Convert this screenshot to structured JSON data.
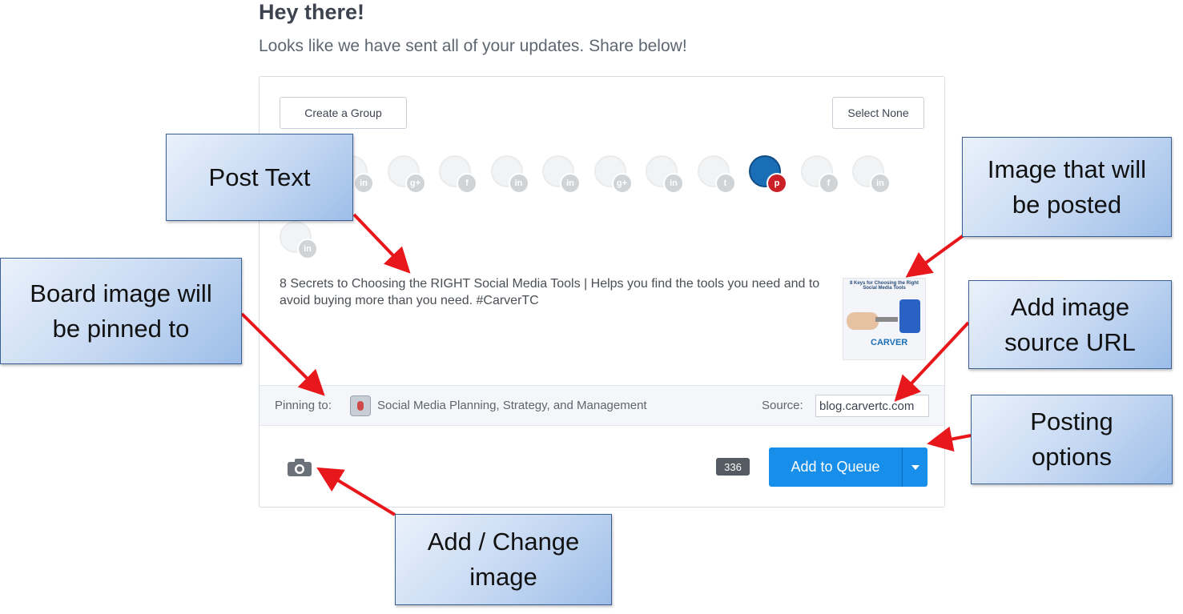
{
  "greeting": {
    "title": "Hey there!",
    "subtitle": "Looks like we have sent all of your updates. Share below!"
  },
  "composer": {
    "create_group_label": "Create a Group",
    "select_none_label": "Select None",
    "profiles": [
      {
        "network": "linkedin",
        "badge": "in",
        "active": false
      },
      {
        "network": "google-plus",
        "badge": "g+",
        "active": false
      },
      {
        "network": "facebook",
        "badge": "f",
        "active": false
      },
      {
        "network": "linkedin",
        "badge": "in",
        "active": false
      },
      {
        "network": "linkedin",
        "badge": "in",
        "active": false
      },
      {
        "network": "google-plus",
        "badge": "g+",
        "active": false
      },
      {
        "network": "linkedin",
        "badge": "in",
        "active": false
      },
      {
        "network": "twitter",
        "badge": "t",
        "active": false
      },
      {
        "network": "pinterest",
        "badge": "p",
        "active": true
      },
      {
        "network": "facebook",
        "badge": "f",
        "active": false
      },
      {
        "network": "linkedin",
        "badge": "in",
        "active": false
      },
      {
        "network": "linkedin",
        "badge": "in",
        "active": false
      }
    ],
    "post_text": "8 Secrets to Choosing the RIGHT Social Media Tools | Helps you find the tools you need and to avoid buying more than you need. #CarverTC",
    "thumbnail": {
      "title": "8 Keys for Choosing the Right Social Media Tools",
      "logo": "CARVER"
    },
    "pin_bar": {
      "pinning_label": "Pinning to:",
      "board_name": "Social Media Planning, Strategy, and Management",
      "source_label": "Source:",
      "source_value": "blog.carvertc.com"
    },
    "char_count": "336",
    "add_to_queue_label": "Add to Queue"
  },
  "callouts": {
    "post_text": [
      "Post Text"
    ],
    "image": [
      "Image that will",
      "be posted"
    ],
    "board": [
      "Board image will",
      "be pinned to"
    ],
    "source": [
      "Add image",
      "source URL"
    ],
    "options": [
      "Posting",
      "options"
    ],
    "change_image": [
      "Add / Change",
      "image"
    ]
  },
  "colors": {
    "primary_button": "#168eea",
    "arrow": "#e8171b",
    "pinterest": "#cb2027"
  },
  "icons": {
    "camera": "camera-icon",
    "caret": "caret-down-icon",
    "board": "board-icon"
  }
}
